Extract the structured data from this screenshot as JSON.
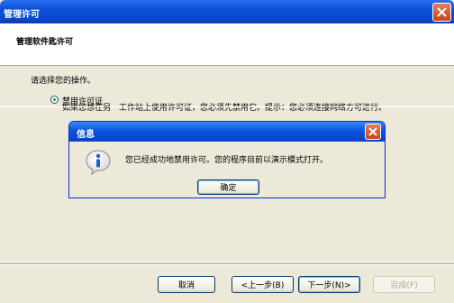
{
  "window": {
    "title": "管理许可"
  },
  "header": {
    "title": "管理软件匙许可"
  },
  "main": {
    "prompt": "请选择您的操作。",
    "option_label": "禁用许可证",
    "option_description": "如果您想在另一工作站上使用许可证，您必须先禁用它。提示：您必须连接网络方可进行。"
  },
  "buttons": {
    "cancel": "取消",
    "back": "<上一步(B)",
    "next": "下一步(N)>",
    "finish": "完成(F)"
  },
  "dialog": {
    "title": "信息",
    "message": "您已经成功地禁用许可。您的程序目前以演示模式打开。",
    "ok": "确定"
  }
}
